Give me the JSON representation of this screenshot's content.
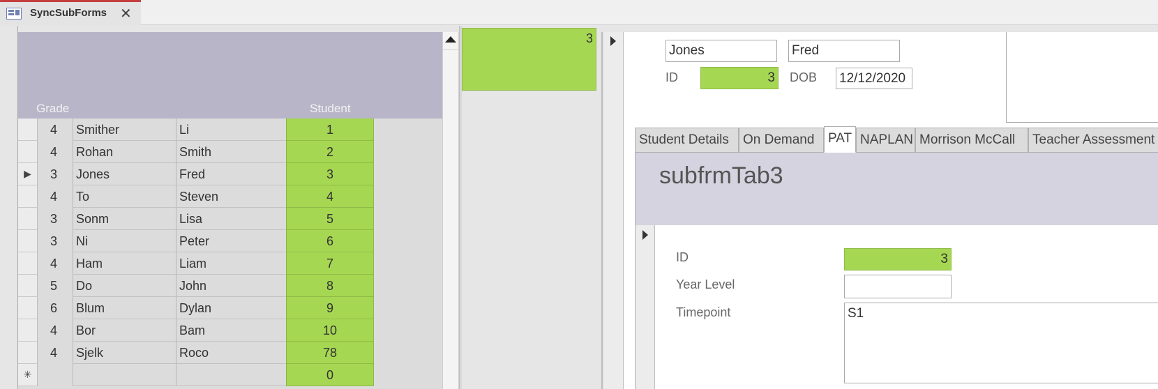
{
  "window": {
    "tab_title": "SyncSubForms",
    "close_glyph": "✕",
    "form_icon": "form-icon"
  },
  "left_subform": {
    "headers": {
      "grade": "Grade",
      "student": "Student"
    },
    "rows": [
      {
        "grade": "4",
        "last": "Smither",
        "first": "Li",
        "id": "1",
        "selector": ""
      },
      {
        "grade": "4",
        "last": "Rohan",
        "first": "Smith",
        "id": "2",
        "selector": ""
      },
      {
        "grade": "3",
        "last": "Jones",
        "first": "Fred",
        "id": "3",
        "selector": "▶"
      },
      {
        "grade": "4",
        "last": "To",
        "first": "Steven",
        "id": "4",
        "selector": ""
      },
      {
        "grade": "3",
        "last": "Sonm",
        "first": "Lisa",
        "id": "5",
        "selector": ""
      },
      {
        "grade": "3",
        "last": "Ni",
        "first": "Peter",
        "id": "6",
        "selector": ""
      },
      {
        "grade": "4",
        "last": "Ham",
        "first": "Liam",
        "id": "7",
        "selector": ""
      },
      {
        "grade": "5",
        "last": "Do",
        "first": "John",
        "id": "8",
        "selector": ""
      },
      {
        "grade": "6",
        "last": "Blum",
        "first": "Dylan",
        "id": "9",
        "selector": ""
      },
      {
        "grade": "4",
        "last": "Bor",
        "first": "Bam",
        "id": "10",
        "selector": ""
      },
      {
        "grade": "4",
        "last": "Sjelk",
        "first": "Roco",
        "id": "78",
        "selector": ""
      }
    ],
    "new_row": {
      "selector": "✳",
      "id": "0"
    }
  },
  "middle_form": {
    "id_value": "3"
  },
  "right_form": {
    "last_name": "Jones",
    "first_name": "Fred",
    "id_label": "ID",
    "id_value": "3",
    "dob_label": "DOB",
    "dob_value": "12/12/2020",
    "tabs": [
      {
        "label": "Student Details",
        "active": false
      },
      {
        "label": "On Demand",
        "active": false
      },
      {
        "label": "PAT",
        "active": true
      },
      {
        "label": "NAPLAN",
        "active": false
      },
      {
        "label": "Morrison McCall",
        "active": false
      },
      {
        "label": "Teacher Assessment",
        "active": false
      }
    ],
    "subform": {
      "title": "subfrmTab3",
      "id_label": "ID",
      "id_value": "3",
      "year_level_label": "Year Level",
      "year_level_value": "",
      "timepoint_label": "Timepoint",
      "timepoint_value": "S1"
    }
  },
  "colors": {
    "key_field_green": "#a6d752",
    "header_lavender": "#b8b5c8",
    "tab_accent_red": "#c43e3e"
  }
}
